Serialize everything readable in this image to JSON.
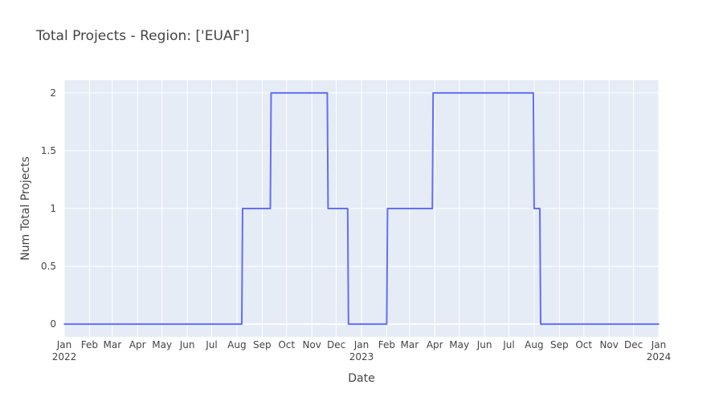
{
  "chart_data": {
    "type": "line",
    "title": "Total Projects - Region: ['EUAF']",
    "xlabel": "Date",
    "ylabel": "Num Total Projects",
    "xlim": [
      "2022-01-01",
      "2024-01-01"
    ],
    "ylim": [
      -0.11,
      2.11
    ],
    "grid": true,
    "line_shape": "step",
    "colors": {
      "plot_bg": "#E5ECF6",
      "grid": "#ffffff",
      "line": "#636EFA",
      "text": "#444444"
    },
    "x_ticks": [
      {
        "date": "2022-01-01",
        "label": "Jan",
        "sublabel": "2022"
      },
      {
        "date": "2022-02-01",
        "label": "Feb"
      },
      {
        "date": "2022-03-01",
        "label": "Mar"
      },
      {
        "date": "2022-04-01",
        "label": "Apr"
      },
      {
        "date": "2022-05-01",
        "label": "May"
      },
      {
        "date": "2022-06-01",
        "label": "Jun"
      },
      {
        "date": "2022-07-01",
        "label": "Jul"
      },
      {
        "date": "2022-08-01",
        "label": "Aug"
      },
      {
        "date": "2022-09-01",
        "label": "Sep"
      },
      {
        "date": "2022-10-01",
        "label": "Oct"
      },
      {
        "date": "2022-11-01",
        "label": "Nov"
      },
      {
        "date": "2022-12-01",
        "label": "Dec"
      },
      {
        "date": "2023-01-01",
        "label": "Jan",
        "sublabel": "2023"
      },
      {
        "date": "2023-02-01",
        "label": "Feb"
      },
      {
        "date": "2023-03-01",
        "label": "Mar"
      },
      {
        "date": "2023-04-01",
        "label": "Apr"
      },
      {
        "date": "2023-05-01",
        "label": "May"
      },
      {
        "date": "2023-06-01",
        "label": "Jun"
      },
      {
        "date": "2023-07-01",
        "label": "Jul"
      },
      {
        "date": "2023-08-01",
        "label": "Aug"
      },
      {
        "date": "2023-09-01",
        "label": "Sep"
      },
      {
        "date": "2023-10-01",
        "label": "Oct"
      },
      {
        "date": "2023-11-01",
        "label": "Nov"
      },
      {
        "date": "2023-12-01",
        "label": "Dec"
      },
      {
        "date": "2024-01-01",
        "label": "Jan",
        "sublabel": "2024"
      }
    ],
    "y_ticks": [
      {
        "value": 0,
        "label": "0"
      },
      {
        "value": 0.5,
        "label": "0.5"
      },
      {
        "value": 1,
        "label": "1"
      },
      {
        "value": 1.5,
        "label": "1.5"
      },
      {
        "value": 2,
        "label": "2"
      }
    ],
    "series": [
      {
        "points": [
          {
            "date": "2022-01-01",
            "y": 0
          },
          {
            "date": "2022-08-07",
            "y": 0
          },
          {
            "date": "2022-08-08",
            "y": 1
          },
          {
            "date": "2022-09-11",
            "y": 1
          },
          {
            "date": "2022-09-12",
            "y": 2
          },
          {
            "date": "2022-11-20",
            "y": 2
          },
          {
            "date": "2022-11-21",
            "y": 1
          },
          {
            "date": "2022-12-15",
            "y": 1
          },
          {
            "date": "2022-12-16",
            "y": 0
          },
          {
            "date": "2023-02-01",
            "y": 0
          },
          {
            "date": "2023-02-02",
            "y": 1
          },
          {
            "date": "2023-03-29",
            "y": 1
          },
          {
            "date": "2023-03-30",
            "y": 2
          },
          {
            "date": "2023-07-31",
            "y": 2
          },
          {
            "date": "2023-08-01",
            "y": 1
          },
          {
            "date": "2023-08-08",
            "y": 1
          },
          {
            "date": "2023-08-09",
            "y": 0
          },
          {
            "date": "2024-01-01",
            "y": 0
          }
        ]
      }
    ]
  }
}
